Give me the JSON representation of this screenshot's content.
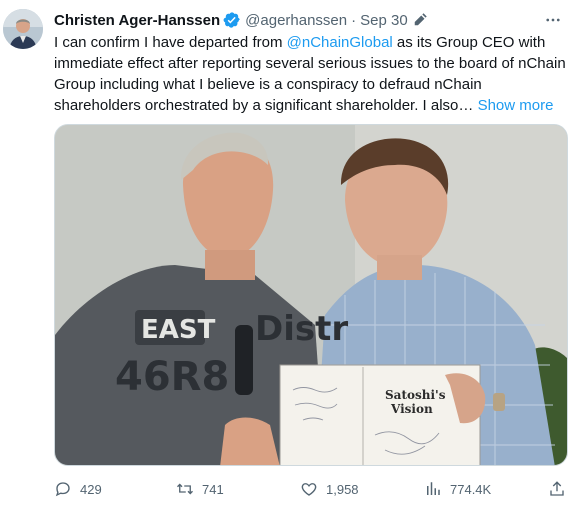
{
  "tweet": {
    "author_name": "Christen Ager-Hanssen",
    "handle": "@agerhanssen",
    "separator": "·",
    "time": "Sep 30",
    "text_parts": [
      "I can confirm I have departed from ",
      "@nChainGlobal",
      " as its Group CEO with immediate effect after reporting several serious issues to the board of nChain Group including what I believe is a conspiracy to defraud nChain shareholders orchestrated by a significant shareholder. I also…"
    ],
    "show_more": "Show more",
    "verified_badge": "verified-icon",
    "media": {
      "book_title_line1": "Satoshi's",
      "book_title_line2": "Vision",
      "shirt_text_line1": "EAST",
      "shirt_text_line2": "46R8",
      "shirt_text_right": "Distr"
    },
    "actions": {
      "replies": "429",
      "reposts": "741",
      "likes": "1,958",
      "views": "774.4K"
    }
  },
  "colors": {
    "link": "#1d9bf0",
    "secondary_text": "#536471",
    "primary_text": "#0f1419"
  }
}
